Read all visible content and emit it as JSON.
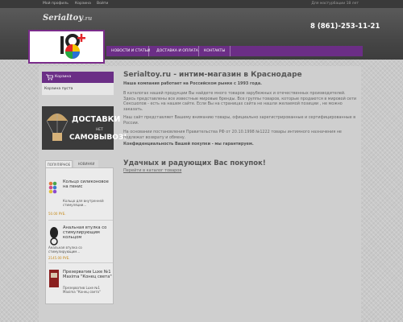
{
  "topbar": {
    "links": [
      "Мой профиль",
      "Корзина",
      "Войти"
    ],
    "age_notice": "Для мастурбации 18 лет"
  },
  "header": {
    "logo_text": "Serialtoy",
    "logo_suffix": ".ru",
    "phone": "8 (861)-253-11-21"
  },
  "nav": {
    "items": [
      "НОВОСТИ И СТАТЬИ",
      "ДОСТАВКА И ОПЛАТА",
      "КОНТАКТЫ"
    ]
  },
  "cart": {
    "title": "Корзина",
    "status": "Корзина пуста"
  },
  "banner": {
    "line1": "ДОСТАВКИ",
    "line2": "НЕТ",
    "line3": "САМОВЫВОЗ!"
  },
  "tabs": [
    "ПОПУЛЯРНОЕ",
    "НОВИНКИ"
  ],
  "products": [
    {
      "name": "Кольцо силиконовое на пенис",
      "desc": "Кольцо для внутренней стимуляции...",
      "price": "50.00 РУБ."
    },
    {
      "name": "Анальная втулка со стимулирующим кольцом",
      "desc": "Анальная втулка со стимулирующим...",
      "price": "2145.00 РУБ."
    },
    {
      "name": "Презерватив Luxe №1 Maxima \"Конец света\"",
      "desc": "Презерватив Luxe №1 Maxima \"Конец света\"",
      "price": ""
    }
  ],
  "content": {
    "title": "Serialtoy.ru - интим-магазин в Краснодаре",
    "lead": "Наша компания работает на Российском рынке с 1993 года.",
    "p1": "В каталогах нашей продукции Вы найдете много товаров зарубежных и отечественных производителей. Здесь представлены все известные мировые бренды. Все группы товаров, которые продаются в мировой сети Сексшопов - есть на нашем сайте. Если Вы на страницах сайта не нашли желаемой позиции , не можно заказать.",
    "p2": "Наш сайт представляет Вашему вниманию товары, официально зарегистрированные и сертифицированные в России.",
    "p3": "На основании постановления Правительства РФ от 20.10.1998 №1222 товары интимного назначения не подлежат возврату и обмену.",
    "p4": "Конфиденциальность Вашей покупки - мы гарантируем.",
    "wish": "Удачных и радующих Вас покупок!",
    "catalog_link": "Перейти в каталог товаров"
  },
  "colors": {
    "accent": "#6b2e86",
    "price": "#c58a1c",
    "topbar": "#3a3a3a"
  }
}
